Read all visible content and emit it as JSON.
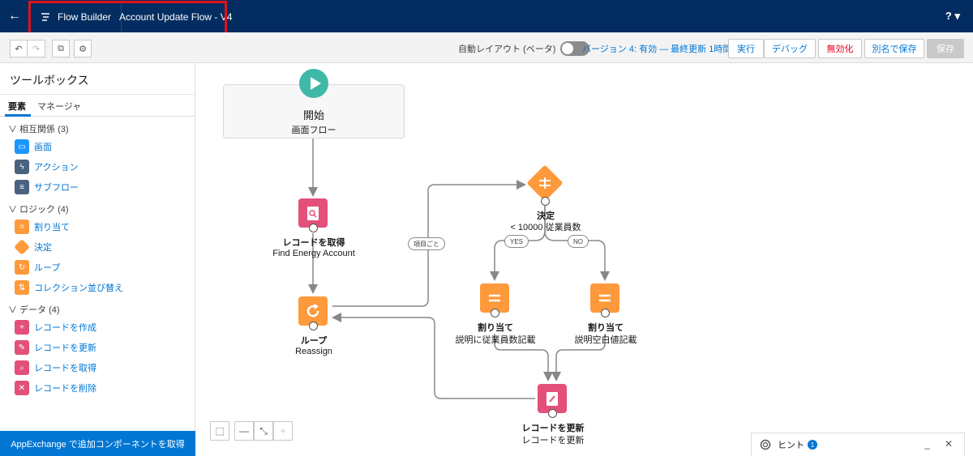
{
  "header": {
    "back_label": "←",
    "app_name": "Flow Builder",
    "flow_name": "Account Update Flow - V4",
    "help_label": "? ▾"
  },
  "toolbar": {
    "undo": "↶",
    "redo": "↷",
    "copy": "⧉",
    "settings": "⚙",
    "auto_layout_label": "自動レイアウト (ベータ)",
    "version_text": "バージョン 4: 有効 — 最終更新 1時間前",
    "run_label": "実行",
    "debug_label": "デバッグ",
    "deactivate_label": "無効化",
    "save_as_label": "別名で保存",
    "save_label": "保存"
  },
  "sidebar": {
    "title": "ツールボックス",
    "tab_elements": "要素",
    "tab_manager": "マネージャ",
    "sections": [
      {
        "label": "∨ 相互関係 (3)",
        "items": [
          "画面",
          "アクション",
          "サブフロー"
        ]
      },
      {
        "label": "∨ ロジック (4)",
        "items": [
          "割り当て",
          "決定",
          "ループ",
          "コレクション並び替え"
        ]
      },
      {
        "label": "∨ データ (4)",
        "items": [
          "レコードを作成",
          "レコードを更新",
          "レコードを取得",
          "レコードを削除"
        ]
      }
    ],
    "footer": "AppExchange で追加コンポーネントを取得"
  },
  "canvas": {
    "start": {
      "title": "開始",
      "subtitle": "画面フロー"
    },
    "get_records": {
      "title": "レコードを取得",
      "subtitle": "Find Energy Account"
    },
    "loop": {
      "title": "ループ",
      "subtitle": "Reassign"
    },
    "loop_edge_label": "項目ごと",
    "decision": {
      "title": "決定",
      "subtitle": "< 10000 従業員数"
    },
    "yes_label": "YES",
    "no_label": "NO",
    "assign1": {
      "title": "割り当て",
      "subtitle": "説明に従業員数記載"
    },
    "assign2": {
      "title": "割り当て",
      "subtitle": "説明空白値記載"
    },
    "update": {
      "title": "レコードを更新",
      "subtitle": "レコードを更新"
    }
  },
  "zoom": {
    "select": "⬚",
    "zoom_out": "—",
    "fit": "⤡",
    "zoom_in": "+"
  },
  "hint": {
    "label": "ヒント",
    "count": "1",
    "minimize": "_",
    "close": "✕"
  }
}
